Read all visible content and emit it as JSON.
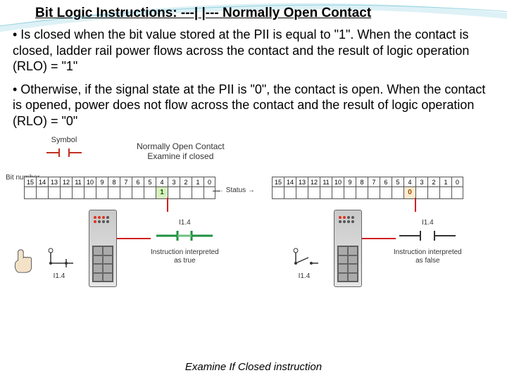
{
  "title": "Bit Logic Instructions: ---| |--- Normally Open Contact",
  "bullets": {
    "p1": "• Is closed when the bit value stored at the PII is equal to \"1\". When the contact is closed, ladder rail power flows across the contact and the result of logic operation (RLO) = \"1\"",
    "p2": "• Otherwise, if the signal state at the PII is \"0\", the contact is open. When the contact is opened, power does not flow across the contact and the result of logic operation (RLO) = \"0\""
  },
  "figure": {
    "symbol_label": "Symbol",
    "examine_label_line1": "Normally Open Contact",
    "examine_label_line2": "Examine if closed",
    "bit_number_label": "Bit number",
    "status_label": "Status",
    "bits": [
      "15",
      "14",
      "13",
      "12",
      "11",
      "10",
      "9",
      "8",
      "7",
      "6",
      "5",
      "4",
      "3",
      "2",
      "1",
      "0"
    ],
    "left_value": "1",
    "right_value": "0",
    "address": "I1.4",
    "left_interp_line1": "Instruction interpreted",
    "left_interp_line2": "as true",
    "right_interp_line1": "Instruction interpreted",
    "right_interp_line2": "as false"
  },
  "caption": "Examine If Closed instruction"
}
